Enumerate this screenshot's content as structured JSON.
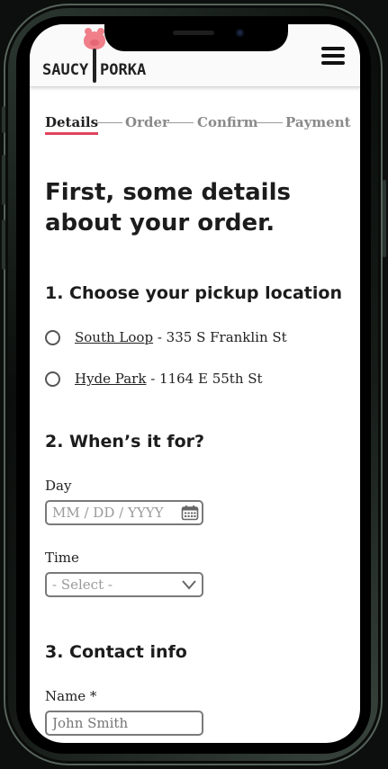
{
  "app": {
    "logo_text_left": "SAUCY",
    "logo_text_right": "PORKA",
    "menu_icon": "hamburger-menu-icon",
    "accent_color": "#e0435e"
  },
  "steps": [
    {
      "label": "Details",
      "active": true
    },
    {
      "label": "Order",
      "active": false
    },
    {
      "label": "Confirm",
      "active": false
    },
    {
      "label": "Payment",
      "active": false
    }
  ],
  "main": {
    "title": "First, some details about your order.",
    "pickup": {
      "heading": "1. Choose your pickup location",
      "options": [
        {
          "name": "South Loop",
          "address": " - 335 S Franklin St"
        },
        {
          "name": "Hyde Park",
          "address": " - 1164 E 55th St"
        }
      ]
    },
    "when": {
      "heading": "2. When’s it for?",
      "day_label": "Day",
      "day_placeholder": "MM / DD / YYYY",
      "day_icon": "calendar-icon",
      "time_label": "Time",
      "time_value": "- Select -",
      "time_icon": "chevron-down-icon"
    },
    "contact": {
      "heading": "3. Contact info",
      "name_label": "Name *",
      "name_placeholder": "John Smith"
    }
  }
}
